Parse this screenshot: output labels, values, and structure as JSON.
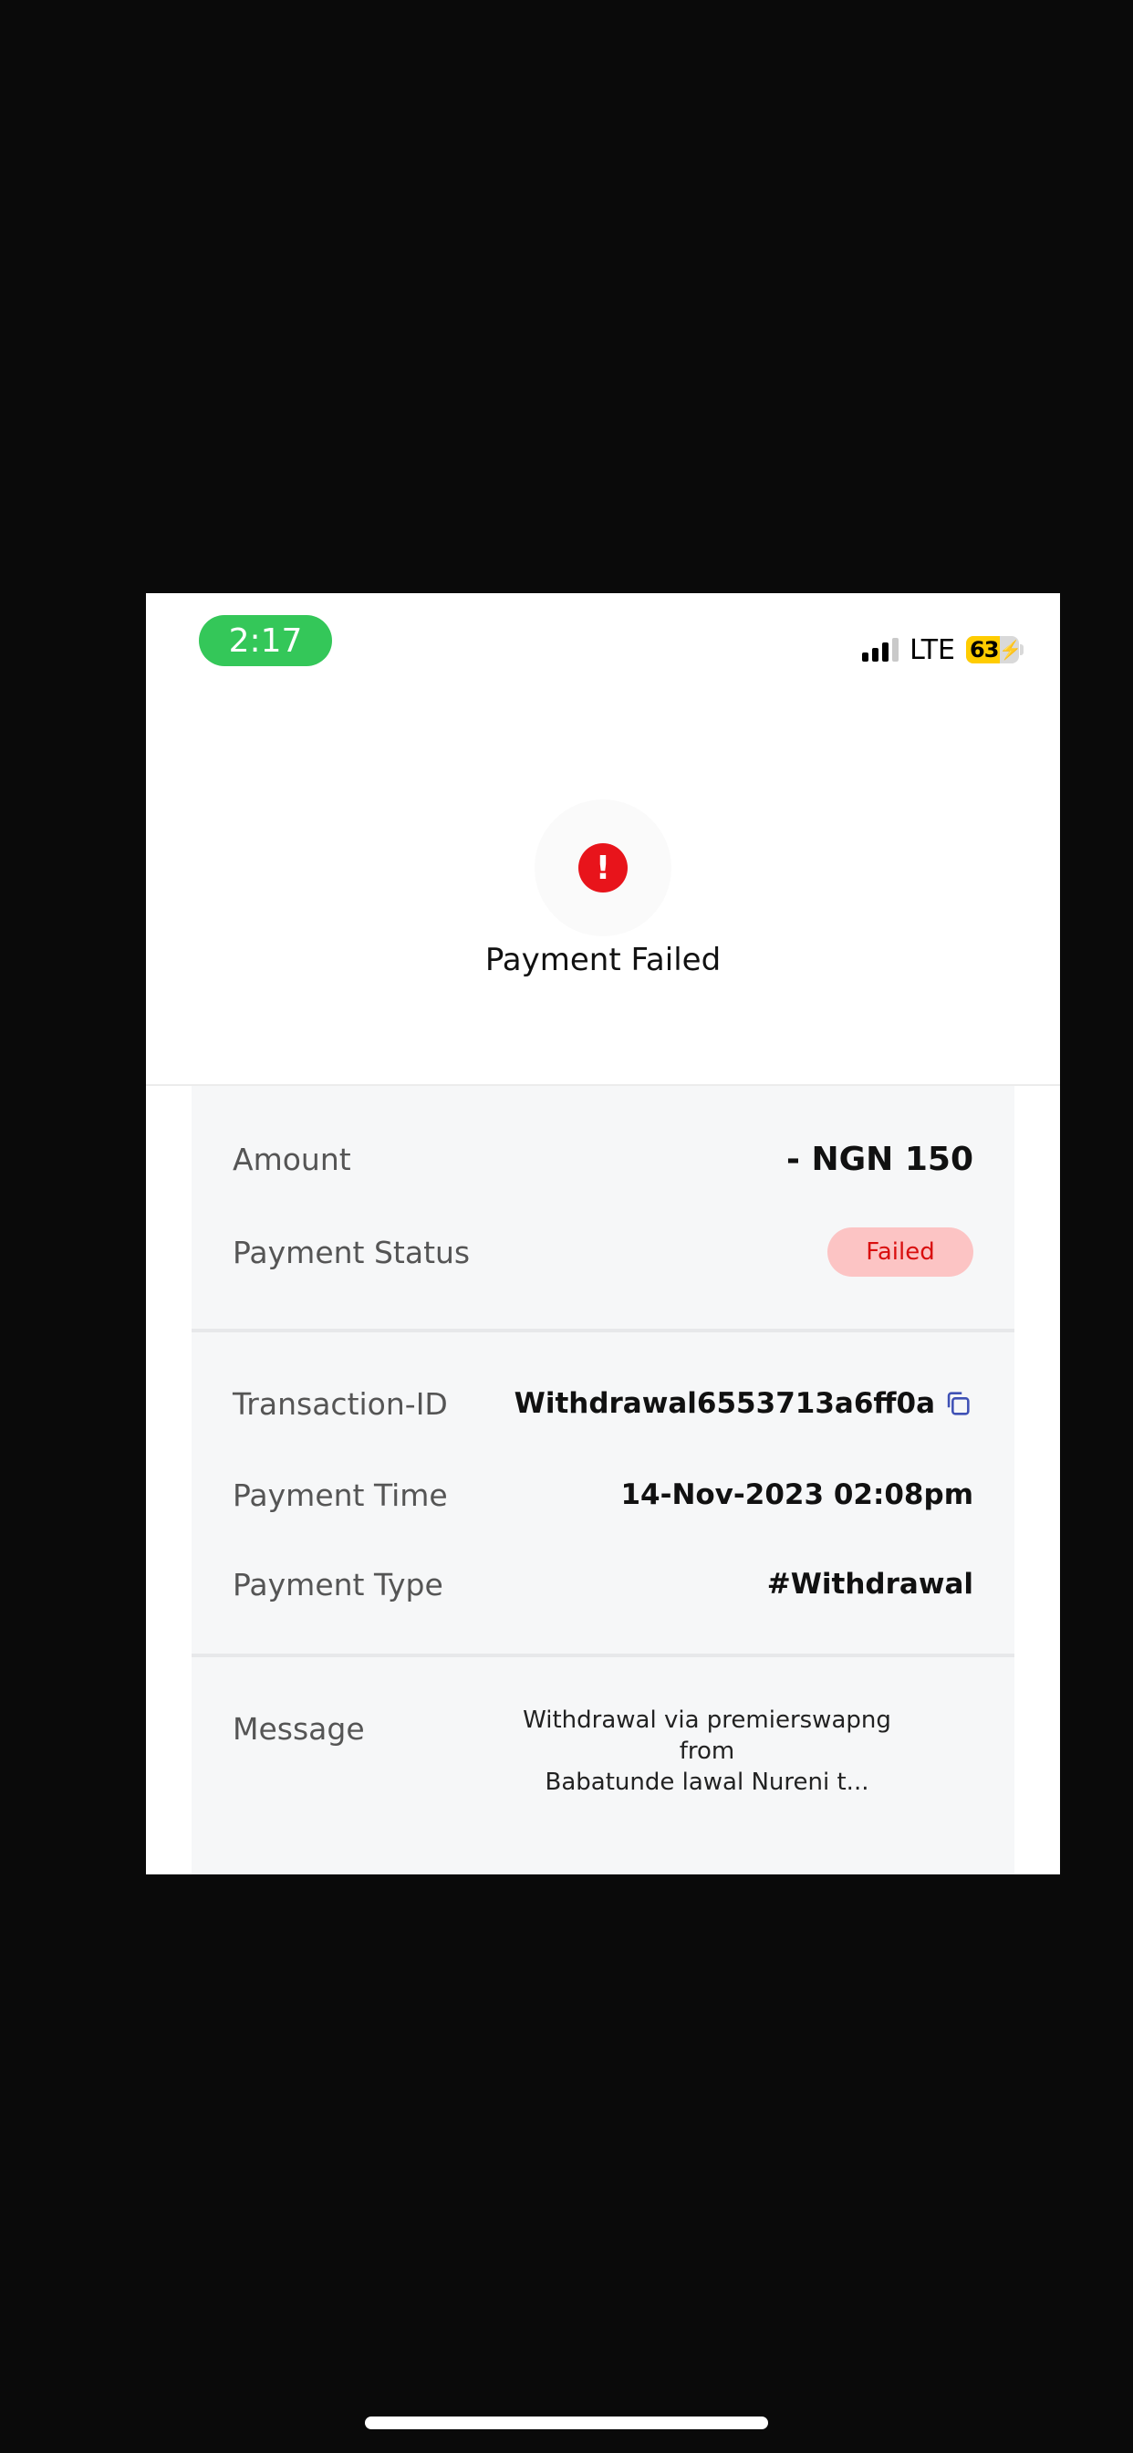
{
  "status_bar": {
    "time": "2:17",
    "network": "LTE",
    "battery_level": "63",
    "battery_fraction": 0.63,
    "signal_bars_active": 3,
    "signal_bars_total": 4
  },
  "header": {
    "icon": "alert-exclamation-icon",
    "title": "Payment Failed"
  },
  "details": {
    "amount_label": "Amount",
    "amount_value": "- NGN 150",
    "status_label": "Payment Status",
    "status_value": "Failed",
    "transaction_id_label": "Transaction-ID",
    "transaction_id_value": "Withdrawal6553713a6ff0a",
    "payment_time_label": "Payment Time",
    "payment_time_value": "14-Nov-2023 02:08pm",
    "payment_type_label": "Payment Type",
    "payment_type_value": "#Withdrawal",
    "message_label": "Message",
    "message_line1": "Withdrawal via premierswapng from",
    "message_line2": "Babatunde lawal Nureni t..."
  },
  "colors": {
    "time_pill": "#34c759",
    "alert_red": "#e8141b",
    "badge_bg": "#fcc4c4",
    "badge_text": "#d90f0f",
    "copy_icon": "#3f51b5",
    "background": "#0a0a0a"
  }
}
